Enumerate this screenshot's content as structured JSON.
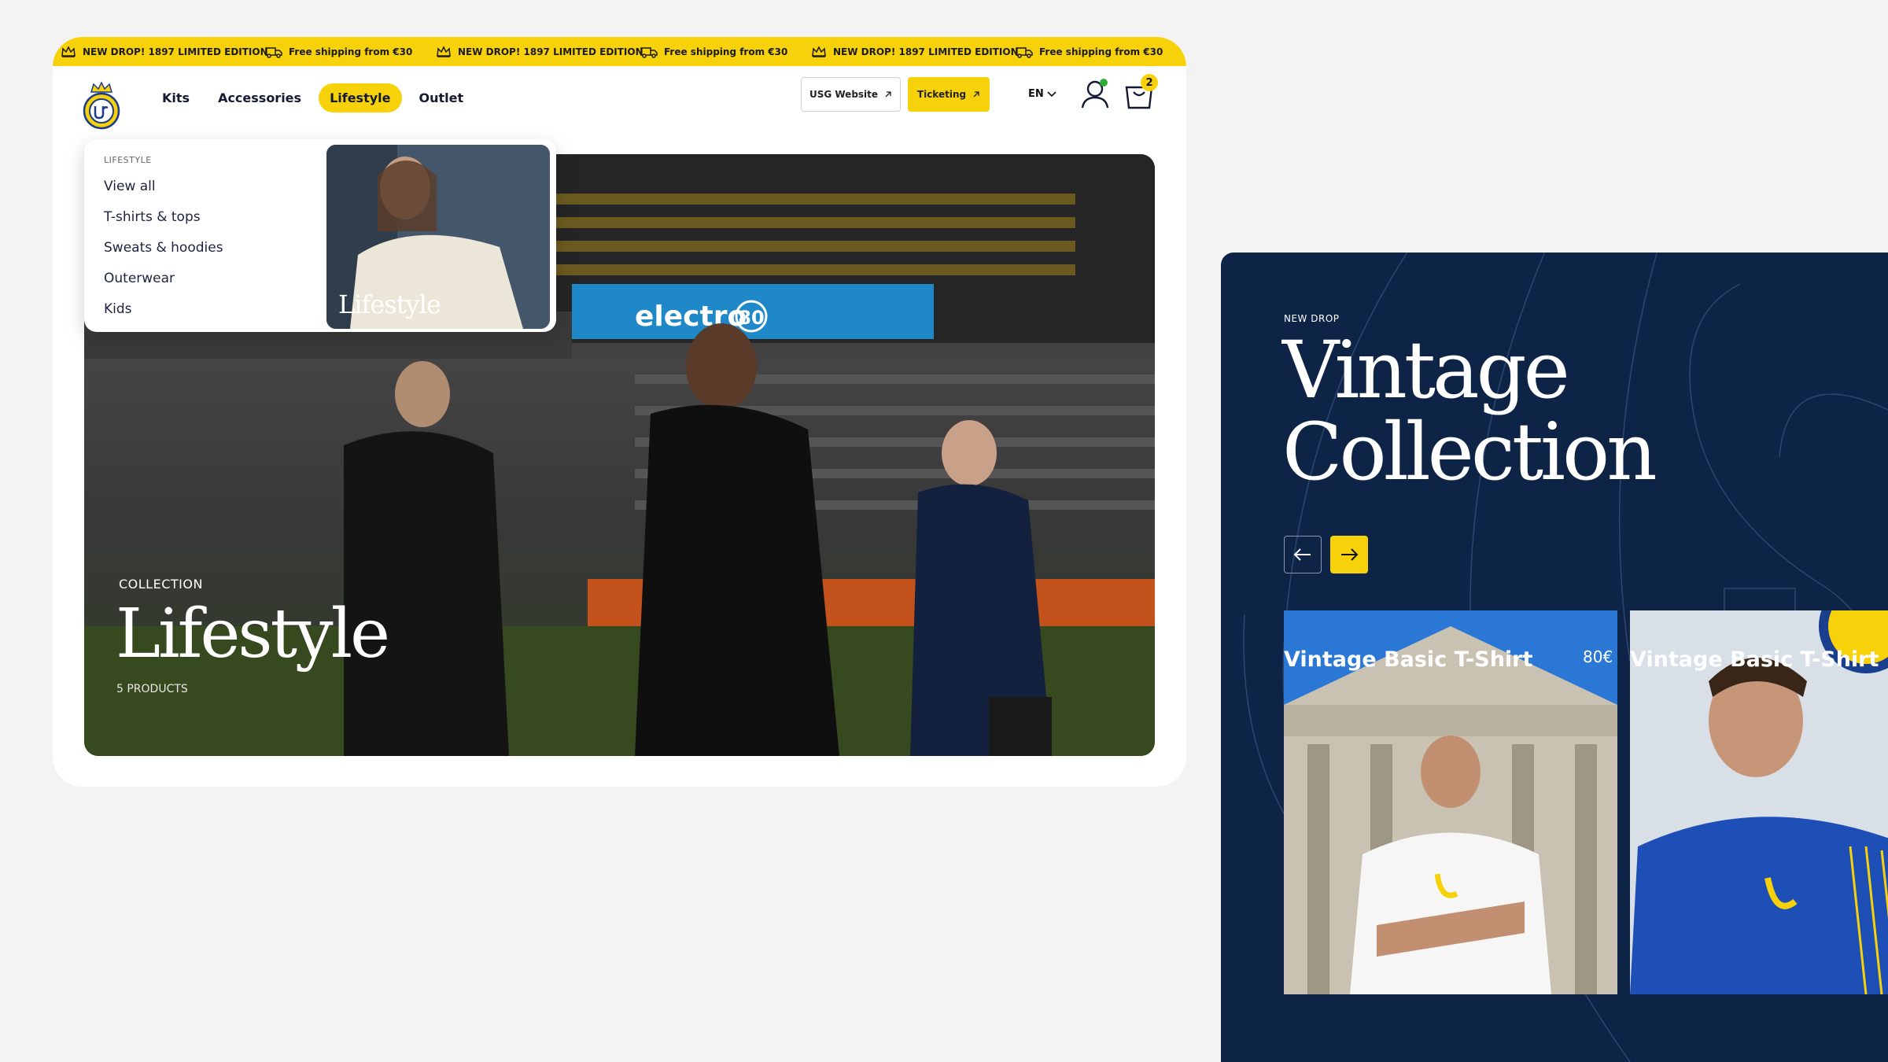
{
  "ticker": {
    "items": [
      {
        "type": "promo",
        "text": "NEW DROP! 1897 LIMITED EDITION"
      },
      {
        "type": "shipping",
        "text": "Free shipping from €30"
      },
      {
        "type": "promo",
        "text": "NEW DROP! 1897 LIMITED EDITION"
      },
      {
        "type": "shipping",
        "text": "Free shipping from €30"
      },
      {
        "type": "promo",
        "text": "NEW DROP! 1897 LIMITED EDITION"
      },
      {
        "type": "shipping",
        "text": "Free shipping from €30"
      }
    ]
  },
  "nav": {
    "items": [
      "Kits",
      "Accessories",
      "Lifestyle",
      "Outlet"
    ],
    "active": "Lifestyle",
    "usg_website": "USG Website",
    "ticketing": "Ticketing",
    "language": "EN",
    "cart_count": "2"
  },
  "dropdown": {
    "heading": "LIFESTYLE",
    "links": [
      "View all",
      "T-shirts & tops",
      "Sweats & hoodies",
      "Outerwear",
      "Kids"
    ],
    "card_title": "Lifestyle"
  },
  "hero": {
    "overline": "COLLECTION",
    "title": "Lifestyle",
    "count": "5 PRODUCTS",
    "signs": {
      "brand": "electro",
      "number": "80"
    }
  },
  "vintage": {
    "overline": "NEW DROP",
    "title_line1": "Vintage",
    "title_line2": "Collection",
    "products": [
      {
        "name": "Vintage Basic T-Shirt",
        "price": "80€"
      },
      {
        "name": "Vintage Basic T-Shirt"
      }
    ]
  },
  "colors": {
    "accent": "#f7d20a",
    "navy": "#0e2447"
  }
}
